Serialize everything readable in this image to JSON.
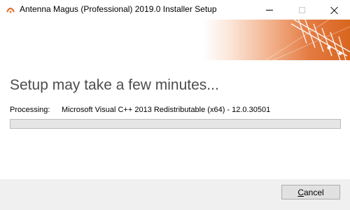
{
  "window": {
    "title": "Antenna Magus (Professional) 2019.0 Installer Setup",
    "app_icon": "antenna-magus-icon",
    "controls": {
      "minimize_icon": "minimize-icon",
      "maximize_icon": "maximize-icon",
      "close_icon": "close-icon"
    }
  },
  "banner": {
    "image": "antenna-banner-graphic",
    "colors": [
      "#ffffff",
      "#e47b43",
      "#d8661f"
    ]
  },
  "main": {
    "heading": "Setup may take a few minutes...",
    "processing_label": "Processing:",
    "processing_value": "Microsoft Visual C++ 2013 Redistributable (x64) - 12.0.30501",
    "progress_percent": 0
  },
  "footer": {
    "cancel_mnemonic": "C",
    "cancel_rest": "ancel"
  }
}
